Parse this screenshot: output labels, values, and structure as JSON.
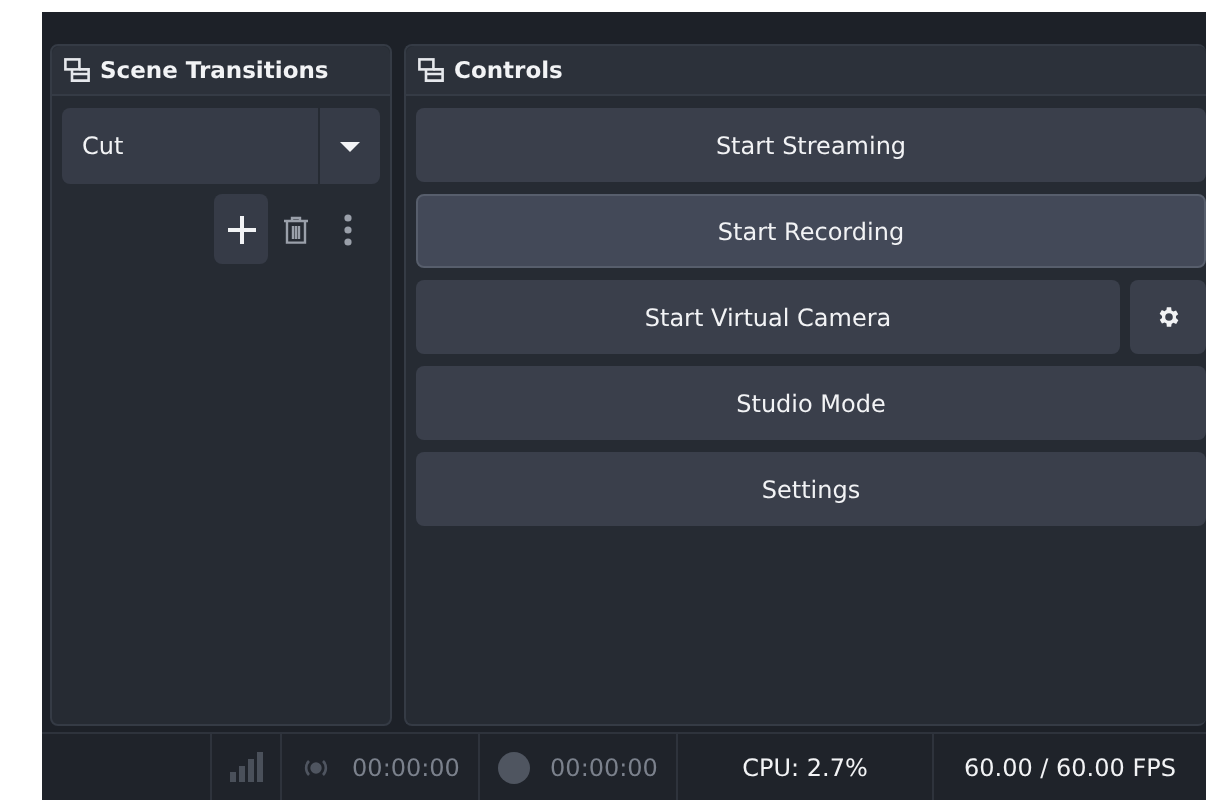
{
  "transitions_dock": {
    "title": "Scene Transitions",
    "transition": {
      "value": "Cut"
    }
  },
  "controls_dock": {
    "title": "Controls",
    "buttons": [
      {
        "label": "Start Streaming",
        "highlighted": false,
        "settings": false
      },
      {
        "label": "Start Recording",
        "highlighted": true,
        "settings": false
      },
      {
        "label": "Start Virtual Camera",
        "highlighted": false,
        "settings": true
      },
      {
        "label": "Studio Mode",
        "highlighted": false,
        "settings": false
      },
      {
        "label": "Settings",
        "highlighted": false,
        "settings": false
      }
    ]
  },
  "status_bar": {
    "stream_time": "00:00:00",
    "record_time": "00:00:00",
    "cpu": "CPU: 2.7%",
    "fps": "60.00 / 60.00 FPS"
  }
}
